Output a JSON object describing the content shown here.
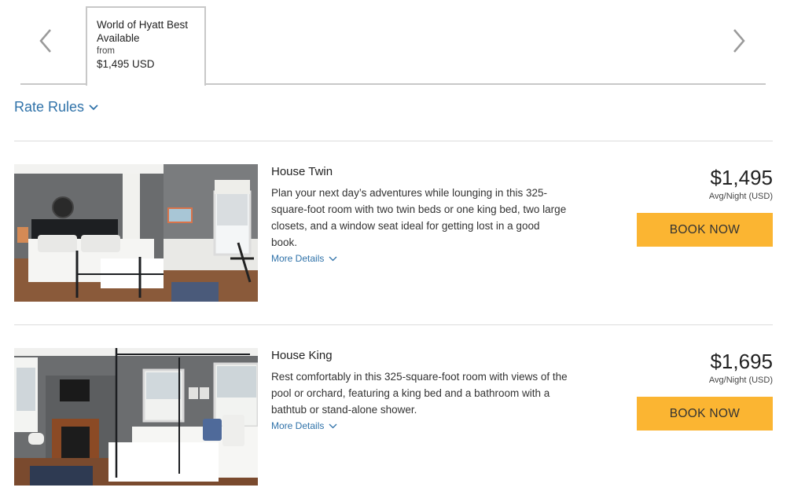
{
  "rate_tab": {
    "title": "World of Hyatt Best Available",
    "from_label": "from",
    "price": "$1,495 USD"
  },
  "rate_rules": {
    "label": "Rate Rules"
  },
  "rooms": [
    {
      "name": "House Twin",
      "description": "Plan your next day’s adventures while lounging in this 325-square-foot room with two twin beds or one king bed, two large closets, and a window seat ideal for getting lost in a good book.",
      "more_details": "More Details",
      "price": "$1,495",
      "price_unit": "Avg/Night (USD)",
      "book_label": "BOOK NOW"
    },
    {
      "name": "House King",
      "description": "Rest comfortably in this 325-square-foot room with views of the pool or orchard, featuring a king bed and a bathroom with a bathtub or stand-alone shower.",
      "more_details": "More Details",
      "price": "$1,695",
      "price_unit": "Avg/Night (USD)",
      "book_label": "BOOK NOW"
    }
  ],
  "icons": {
    "prev": "chevron-left-icon",
    "next": "chevron-right-icon",
    "expand": "chevron-down-icon"
  },
  "colors": {
    "accent_link": "#2f72a9",
    "book_button": "#fbb532",
    "divider": "#dcdcdc"
  }
}
